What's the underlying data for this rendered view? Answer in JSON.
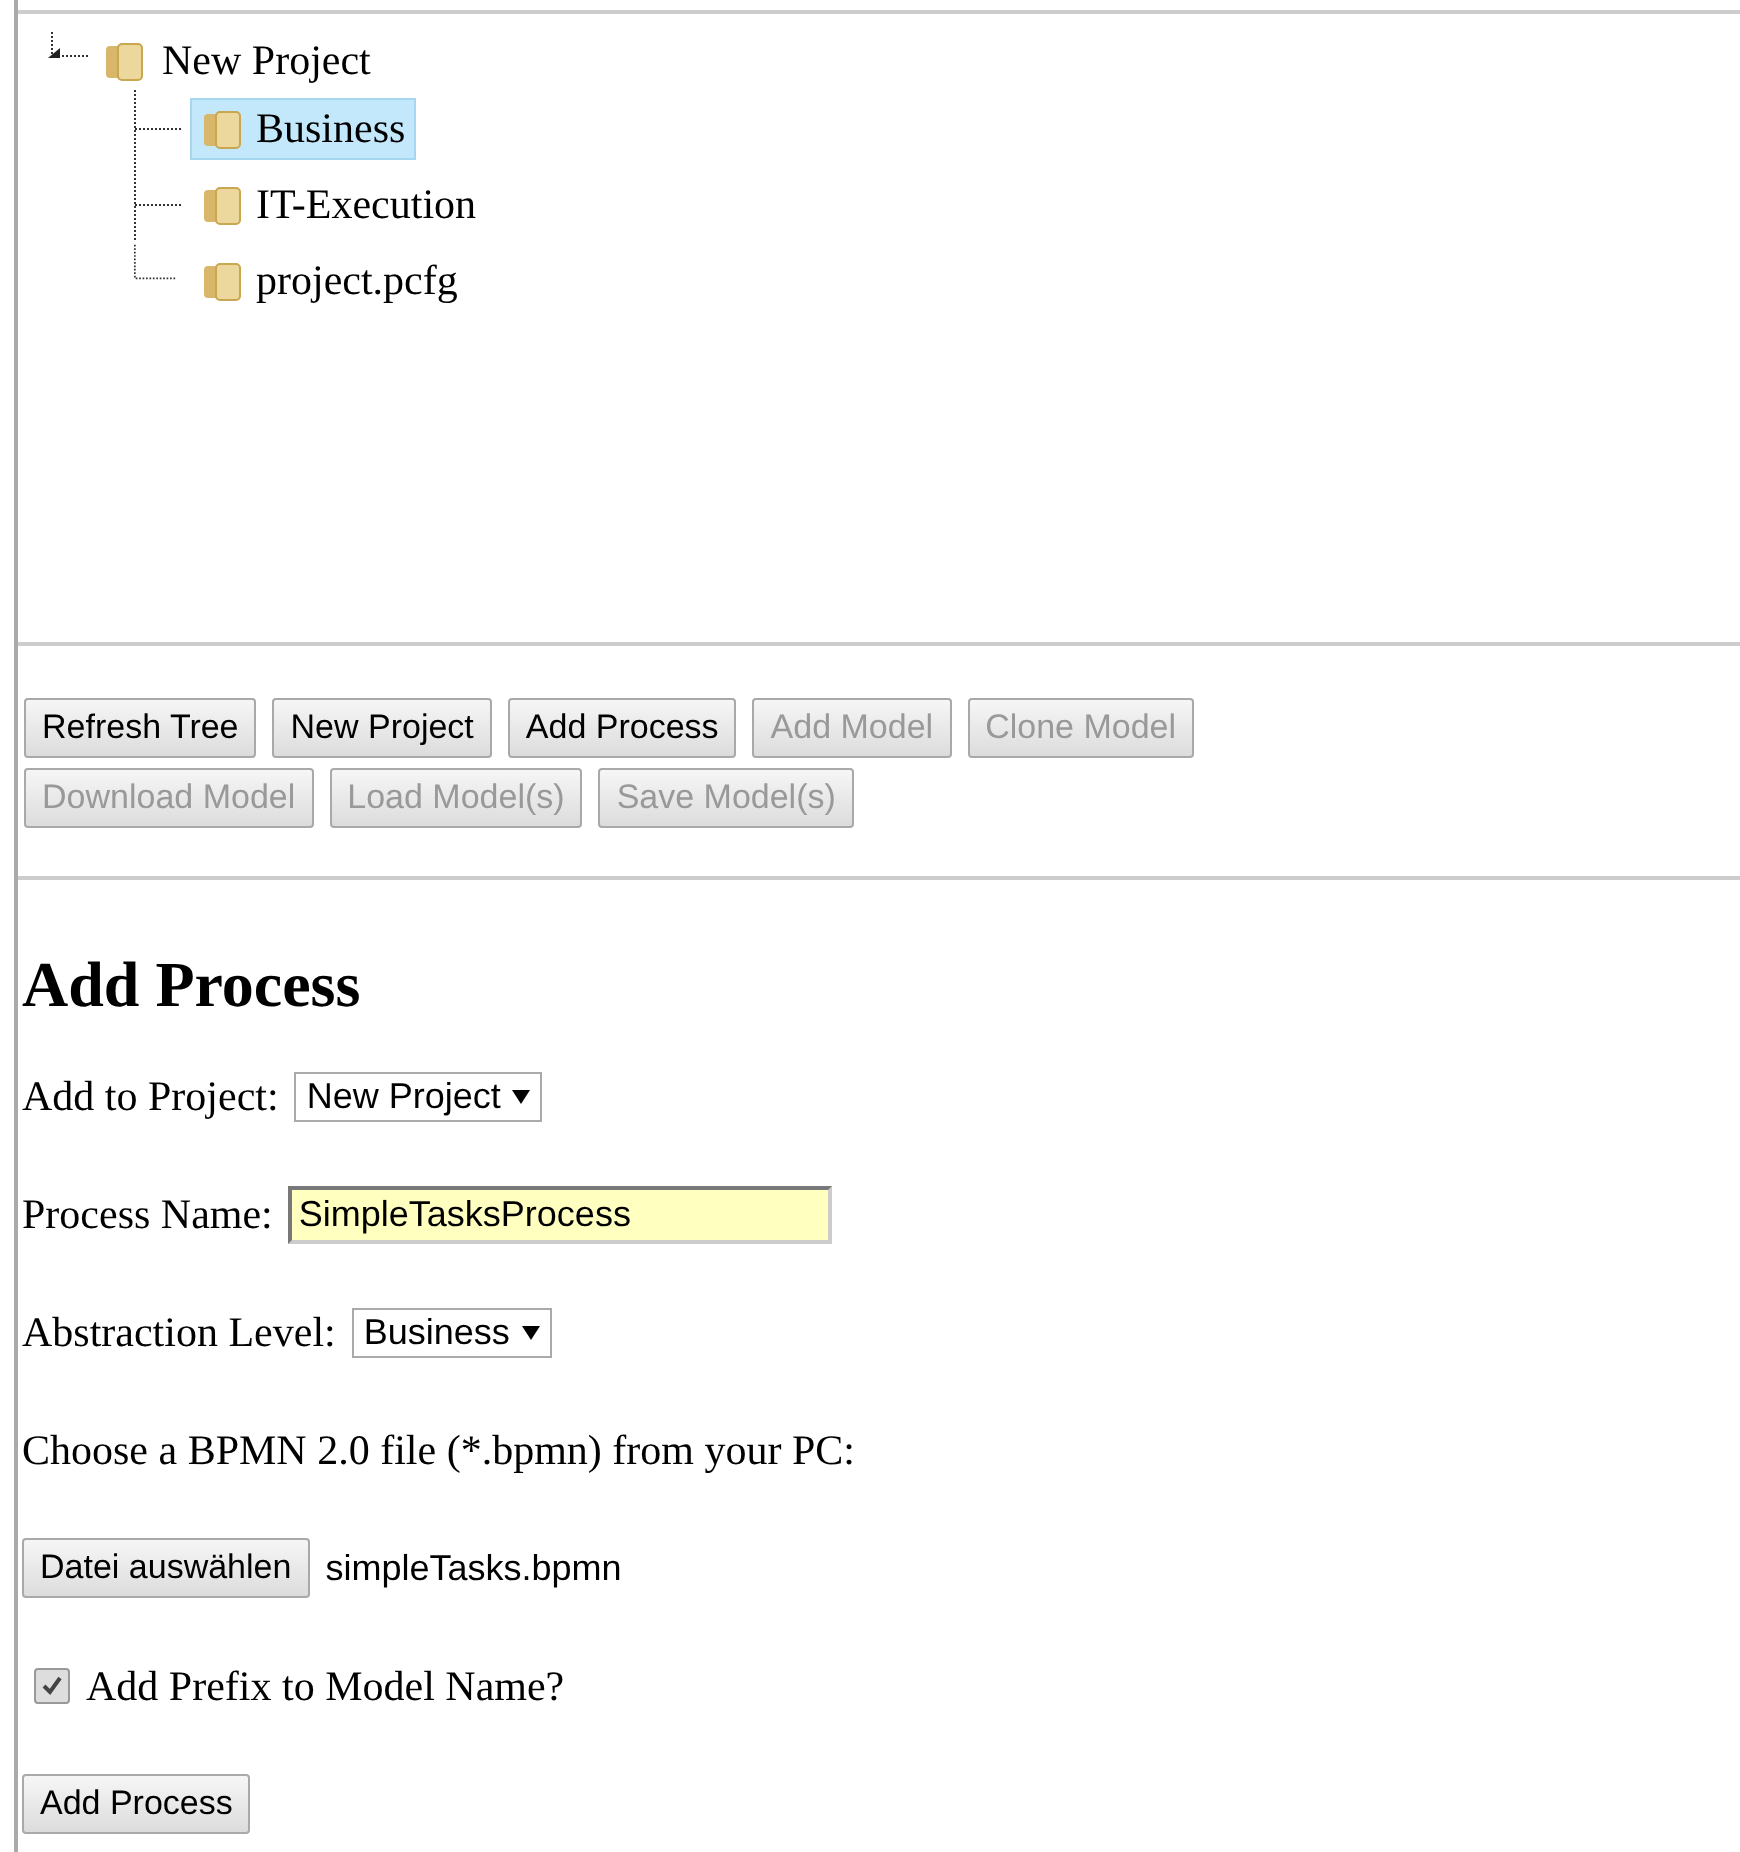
{
  "tree": {
    "label": "New Project",
    "expanded": true,
    "children": [
      {
        "label": "Business",
        "selected": true
      },
      {
        "label": "IT-Execution",
        "selected": false
      },
      {
        "label": "project.pcfg",
        "selected": false
      }
    ]
  },
  "toolbar": [
    {
      "label": "Refresh Tree",
      "disabled": false
    },
    {
      "label": "New Project",
      "disabled": false
    },
    {
      "label": "Add Process",
      "disabled": false
    },
    {
      "label": "Add Model",
      "disabled": true
    },
    {
      "label": "Clone Model",
      "disabled": true
    },
    {
      "label": "Download Model",
      "disabled": true
    },
    {
      "label": "Load Model(s)",
      "disabled": true
    },
    {
      "label": "Save Model(s)",
      "disabled": true
    }
  ],
  "heading": "Add Process",
  "form": {
    "project": {
      "label": "Add to Project:",
      "value": "New Project"
    },
    "name": {
      "label": "Process Name:",
      "value": "SimpleTasksProcess"
    },
    "level": {
      "label": "Abstraction Level:",
      "value": "Business"
    },
    "file_prompt": "Choose a BPMN 2.0 file (*.bpmn) from your PC:",
    "file_button": "Datei auswählen",
    "file_name": "simpleTasks.bpmn",
    "prefix": {
      "label": "Add Prefix to Model Name?",
      "checked": true
    },
    "submit": "Add Process"
  }
}
